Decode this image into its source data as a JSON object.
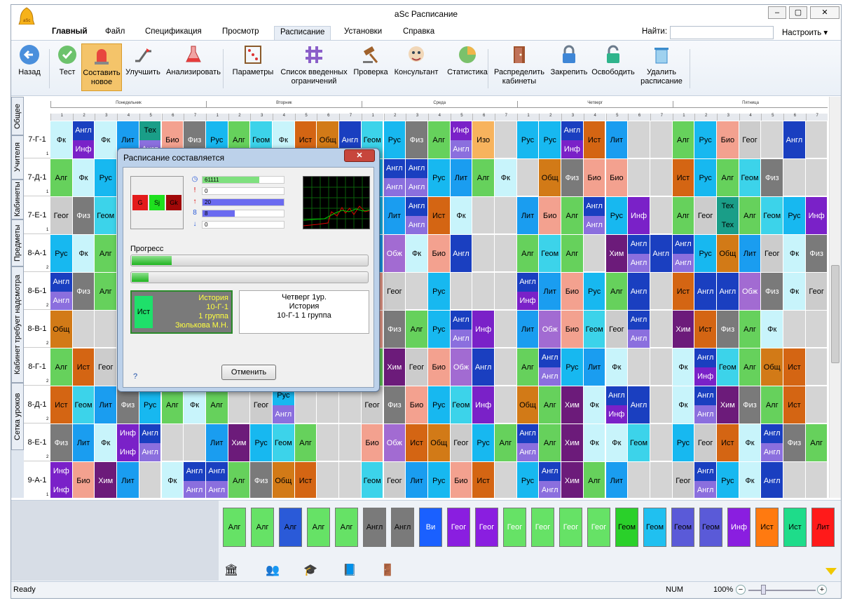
{
  "app": {
    "title": "aSc Расписание"
  },
  "menu": {
    "tabs": [
      "Главный",
      "Файл",
      "Спецификация",
      "Просмотр",
      "Расписание",
      "Установки",
      "Справка"
    ],
    "active": "Расписание",
    "find_label": "Найти:",
    "customize_label": "Настроить ▾"
  },
  "ribbon": {
    "buttons": [
      {
        "label": "Назад",
        "icon": "back-arrow-icon"
      },
      {
        "label": "Тест",
        "icon": "check-badge-icon"
      },
      {
        "label": "Составить новое",
        "icon": "alarm-light-icon",
        "selected": true
      },
      {
        "label": "Улучшить",
        "icon": "escalator-icon"
      },
      {
        "label": "Анализировать",
        "icon": "flask-icon"
      },
      {
        "label": "Параметры",
        "icon": "abacus-icon"
      },
      {
        "label": "Список введенных ограничений",
        "icon": "grid-hash-icon"
      },
      {
        "label": "Проверка",
        "icon": "gavel-icon"
      },
      {
        "label": "Консультант",
        "icon": "consultant-icon"
      },
      {
        "label": "Статистика",
        "icon": "pie-chart-icon"
      },
      {
        "label": "Распределить кабинеты",
        "icon": "door-icon"
      },
      {
        "label": "Закрепить",
        "icon": "lock-closed-icon"
      },
      {
        "label": "Освободить",
        "icon": "lock-open-icon"
      },
      {
        "label": "Удалить расписание",
        "icon": "recycle-bin-icon"
      }
    ]
  },
  "side_tabs": [
    "Общее",
    "Учителя",
    "Кабинеты",
    "Предметы",
    "Кабинет требует надсмотра",
    "Сетка уроков"
  ],
  "days": [
    "Понедельник",
    "Вторник",
    "Среда",
    "Четверг",
    "Пятница"
  ],
  "periods": [
    "1",
    "2",
    "3",
    "4",
    "5",
    "6",
    "7"
  ],
  "colors": {
    "Рус": "#17b8f0",
    "Алг": "#66d15c",
    "Геом": "#3cd3ea",
    "Фк": "#c8f4fb",
    "Лит": "#1a9df0",
    "Физ": "#7a7a7a",
    "Ист": "#d46513",
    "Биол": "#f3a18f",
    "Био": "#f3a18f",
    "Инф": "#7a21c8",
    "Англ": "#1a3fc0",
    "Англ2": "#8b6fde",
    "Хим": "#6c1b7a",
    "Общ": "#d27a17",
    "Тех": "#1a9e88",
    "Изо": "#f7b35d",
    "Обж": "#a26bd2",
    "Geo": "#13c6c6"
  },
  "rows": [
    {
      "label": "7-Г-1",
      "sub": "1",
      "cells": [
        [
          "Фк"
        ],
        [
          "Англ",
          "Инф"
        ],
        [
          "Фк"
        ],
        [
          "Лит"
        ],
        [
          "Тех",
          "Англ"
        ],
        [
          "Био"
        ],
        [
          "Физ"
        ],
        [
          "Рус"
        ],
        [
          "Алг"
        ],
        [
          "Геом"
        ],
        [
          "Фк"
        ],
        [
          "Ист"
        ],
        [
          "Общ"
        ],
        [
          "Англ"
        ],
        [
          "Геом"
        ],
        [
          "Рус"
        ],
        [
          "Физ"
        ],
        [
          "Алг"
        ],
        [
          "Инф",
          "Англ"
        ],
        [
          "Изо"
        ],
        [],
        [
          "Рус"
        ],
        [
          "Рус"
        ],
        [
          "Англ",
          "Инф"
        ],
        [
          "Ист"
        ],
        [
          "Лит"
        ],
        [],
        [],
        [
          "Алг"
        ],
        [
          "Рус"
        ],
        [
          "Био"
        ],
        [
          "Геог"
        ],
        [],
        [
          "Англ"
        ],
        []
      ]
    },
    {
      "label": "7-Д-1",
      "sub": "1",
      "cells": [
        [
          "Алг"
        ],
        [
          "Фк"
        ],
        [
          "Рус"
        ],
        [],
        [],
        [],
        [],
        [],
        [],
        [],
        [],
        [],
        [],
        [],
        [
          "Рус"
        ],
        [
          "Англ",
          "Англ"
        ],
        [
          "Англ",
          "Англ"
        ],
        [
          "Рус"
        ],
        [
          "Лит"
        ],
        [
          "Алг"
        ],
        [
          "Фк"
        ],
        [],
        [
          "Общ"
        ],
        [
          "Физ"
        ],
        [
          "Био"
        ],
        [
          "Био"
        ],
        [],
        [],
        [
          "Ист"
        ],
        [
          "Рус"
        ],
        [
          "Алг"
        ],
        [
          "Геом"
        ],
        [
          "Физ"
        ],
        [],
        []
      ]
    },
    {
      "label": "7-Е-1",
      "sub": "1",
      "cells": [
        [
          "Геог"
        ],
        [
          "Физ"
        ],
        [
          "Геом"
        ],
        [],
        [],
        [],
        [],
        [],
        [],
        [],
        [],
        [],
        [],
        [],
        [
          "Рус"
        ],
        [
          "Лит"
        ],
        [
          "Англ",
          "Англ"
        ],
        [
          "Ист"
        ],
        [
          "Фк"
        ],
        [],
        [],
        [
          "Лит"
        ],
        [
          "Био"
        ],
        [
          "Алг"
        ],
        [
          "Англ",
          "Англ"
        ],
        [
          "Рус"
        ],
        [
          "Инф"
        ],
        [],
        [
          "Алг"
        ],
        [
          "Геог"
        ],
        [
          "Тех",
          "Тех"
        ],
        [
          "Алг"
        ],
        [
          "Геом"
        ],
        [
          "Рус"
        ],
        [
          "Инф"
        ]
      ]
    },
    {
      "label": "8-А-1",
      "sub": "2",
      "cells": [
        [
          "Рус"
        ],
        [
          "Фк"
        ],
        [
          "Алг"
        ],
        [],
        [],
        [],
        [],
        [],
        [],
        [],
        [],
        [],
        [],
        [],
        [
          "Лит"
        ],
        [
          "Обж"
        ],
        [
          "Фк"
        ],
        [
          "Био"
        ],
        [
          "Англ"
        ],
        [],
        [],
        [
          "Алг"
        ],
        [
          "Геом"
        ],
        [
          "Алг"
        ],
        [],
        [
          "Хим"
        ],
        [
          "Англ",
          "Англ"
        ],
        [
          "Англ"
        ],
        [
          "Англ",
          "Англ"
        ],
        [
          "Рус"
        ],
        [
          "Общ"
        ],
        [
          "Лит"
        ],
        [
          "Геог"
        ],
        [
          "Фк"
        ],
        [
          "Физ"
        ]
      ]
    },
    {
      "label": "8-Б-1",
      "sub": "2",
      "cells": [
        [
          "Англ",
          "Англ"
        ],
        [
          "Физ"
        ],
        [
          "Алг"
        ],
        [],
        [],
        [],
        [],
        [],
        [],
        [],
        [],
        [],
        [],
        [],
        [
          "Био"
        ],
        [
          "Геог"
        ],
        [],
        [
          "Рус"
        ],
        [],
        [],
        [],
        [
          "Англ",
          "Инф"
        ],
        [
          "Лит"
        ],
        [
          "Био"
        ],
        [
          "Рус"
        ],
        [
          "Алг"
        ],
        [
          "Англ"
        ],
        [],
        [
          "Ист"
        ],
        [
          "Англ"
        ],
        [
          "Англ"
        ],
        [
          "Обж"
        ],
        [
          "Физ"
        ],
        [
          "Фк"
        ],
        [
          "Геог"
        ]
      ]
    },
    {
      "label": "8-В-1",
      "sub": "2",
      "cells": [
        [
          "Общ"
        ],
        [],
        [],
        [],
        [],
        [],
        [],
        [],
        [],
        [],
        [],
        [],
        [],
        [],
        [
          "Био"
        ],
        [
          "Физ"
        ],
        [
          "Алг"
        ],
        [
          "Рус"
        ],
        [
          "Англ",
          "Англ"
        ],
        [
          "Инф"
        ],
        [],
        [
          "Лит"
        ],
        [
          "Обж"
        ],
        [
          "Био"
        ],
        [
          "Геом"
        ],
        [
          "Геог"
        ],
        [
          "Англ",
          "Англ"
        ],
        [],
        [
          "Хим"
        ],
        [
          "Ист"
        ],
        [
          "Физ"
        ],
        [
          "Алг"
        ],
        [
          "Фк"
        ],
        [],
        []
      ]
    },
    {
      "label": "8-Г-1",
      "sub": "2",
      "cells": [
        [
          "Алг"
        ],
        [
          "Ист"
        ],
        [
          "Геог"
        ],
        [],
        [],
        [],
        [],
        [],
        [],
        [],
        [],
        [],
        [],
        [],
        [
          "Алг"
        ],
        [
          "Хим"
        ],
        [
          "Геог"
        ],
        [
          "Био"
        ],
        [
          "Обж"
        ],
        [
          "Англ"
        ],
        [],
        [
          "Алг"
        ],
        [
          "Англ",
          "Англ"
        ],
        [
          "Рус"
        ],
        [
          "Лит"
        ],
        [
          "Фк"
        ],
        [],
        [],
        [
          "Фк"
        ],
        [
          "Англ",
          "Инф"
        ],
        [
          "Геом"
        ],
        [
          "Алг"
        ],
        [
          "Общ"
        ],
        [
          "Ист"
        ],
        []
      ]
    },
    {
      "label": "8-Д-1",
      "sub": "2",
      "cells": [
        [
          "Ист"
        ],
        [
          "Геом"
        ],
        [
          "Лит"
        ],
        [
          "Физ"
        ],
        [
          "Рус"
        ],
        [
          "Алг"
        ],
        [
          "Фк"
        ],
        [
          "Алг"
        ],
        [],
        [
          "Геог"
        ],
        [
          "Рус",
          "Англ"
        ],
        [],
        [],
        [],
        [
          "Геог"
        ],
        [
          "Физ"
        ],
        [
          "Био"
        ],
        [
          "Рус"
        ],
        [
          "Геом"
        ],
        [
          "Инф"
        ],
        [],
        [
          "Общ"
        ],
        [
          "Алг"
        ],
        [
          "Хим"
        ],
        [
          "Фк"
        ],
        [
          "Англ",
          "Инф"
        ],
        [
          "Англ"
        ],
        [],
        [
          "Фк"
        ],
        [
          "Англ",
          "Англ"
        ],
        [
          "Хим"
        ],
        [
          "Физ"
        ],
        [
          "Алг"
        ],
        [
          "Ист"
        ],
        []
      ]
    },
    {
      "label": "8-Е-1",
      "sub": "2",
      "cells": [
        [
          "Физ"
        ],
        [
          "Лит"
        ],
        [
          "Фк"
        ],
        [
          "Инф",
          "Инф"
        ],
        [
          "Англ",
          "Англ"
        ],
        [],
        [],
        [
          "Лит"
        ],
        [
          "Хим"
        ],
        [
          "Рус"
        ],
        [
          "Геом"
        ],
        [
          "Алг"
        ],
        [],
        [],
        [
          "Био"
        ],
        [
          "Обж"
        ],
        [
          "Ист"
        ],
        [
          "Общ"
        ],
        [
          "Геог"
        ],
        [
          "Рус"
        ],
        [
          "Алг"
        ],
        [
          "Англ",
          "Англ"
        ],
        [
          "Алг"
        ],
        [
          "Хим"
        ],
        [
          "Фк"
        ],
        [
          "Фк"
        ],
        [
          "Геом"
        ],
        [],
        [
          "Рус"
        ],
        [
          "Геог"
        ],
        [
          "Ист"
        ],
        [
          "Фк"
        ],
        [
          "Англ",
          "Англ"
        ],
        [
          "Физ"
        ],
        [
          "Алг"
        ]
      ]
    },
    {
      "label": "9-А-1",
      "sub": "1",
      "cells": [
        [
          "Инф",
          "Инф"
        ],
        [
          "Био"
        ],
        [
          "Хим"
        ],
        [
          "Лит"
        ],
        [],
        [
          "Фк"
        ],
        [
          "Англ",
          "Англ"
        ],
        [
          "Англ",
          "Англ"
        ],
        [
          "Алг"
        ],
        [
          "Физ"
        ],
        [
          "Общ"
        ],
        [
          "Ист"
        ],
        [],
        [],
        [
          "Геом"
        ],
        [
          "Геог"
        ],
        [
          "Лит"
        ],
        [
          "Рус"
        ],
        [
          "Био"
        ],
        [
          "Ист"
        ],
        [],
        [
          "Рус"
        ],
        [
          "Англ",
          "Англ"
        ],
        [
          "Хим"
        ],
        [
          "Алг"
        ],
        [
          "Лит"
        ],
        [],
        [],
        [
          "Геог"
        ],
        [
          "Англ",
          "Англ"
        ],
        [
          "Рус"
        ],
        [
          "Фк"
        ],
        [
          "Англ"
        ],
        [],
        []
      ]
    }
  ],
  "cards": [
    {
      "label": "Алг"
    },
    {
      "label": "Алг"
    },
    {
      "label": "Алг"
    },
    {
      "label": "Алг",
      "label2": "Алг"
    },
    {
      "label": "Алг"
    },
    {
      "label": "Англ"
    },
    {
      "label": "Англ"
    },
    {
      "label": "Ви"
    },
    {
      "label": "Геог"
    },
    {
      "label": "Геог"
    },
    {
      "label": "Геог"
    },
    {
      "label": "Геог"
    },
    {
      "label": "Геог"
    },
    {
      "label": "Геог"
    },
    {
      "label": "Геом"
    },
    {
      "label": "Геом"
    },
    {
      "label": "Геом"
    },
    {
      "label": "Геом"
    },
    {
      "label": "Инф"
    },
    {
      "label": "Ист"
    },
    {
      "label": "Ист"
    },
    {
      "label": "Лит"
    }
  ],
  "dialog": {
    "title": "Расписание составляется",
    "chips": [
      "G",
      "Sj",
      "Gk"
    ],
    "stats": [
      {
        "icon": "clock-icon",
        "value": "61111",
        "fill": 0.7
      },
      {
        "icon": "exclamation-icon",
        "value": "0",
        "fill": 0
      },
      {
        "icon": "up-arrow-icon",
        "value": "20",
        "fill": 1.0
      },
      {
        "icon": "eight-icon",
        "value": "8",
        "fill": 0.4
      },
      {
        "icon": "down-arrow-icon",
        "value": "0",
        "fill": 0
      }
    ],
    "progress_label": "Прогресс",
    "progress": [
      0.17,
      0.07
    ],
    "lesson": {
      "abbr": "Ист",
      "subject": "История",
      "class": "10-Г-1",
      "group": "1 группа",
      "teacher": "Зюлькова М.Н."
    },
    "info": [
      "Четверг 1ур.",
      "История",
      "10-Г-1 1 группа"
    ],
    "help": "?",
    "cancel": "Отменить"
  },
  "status": {
    "left": "Ready",
    "num": "NUM",
    "zoom": "100%"
  }
}
